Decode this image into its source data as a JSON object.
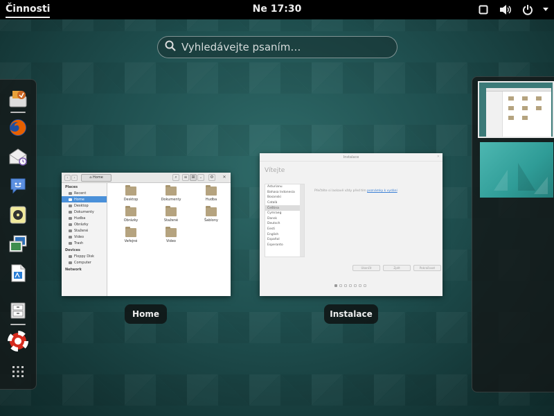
{
  "topbar": {
    "activities": "Činnosti",
    "clock": "Ne 17:30",
    "tray_icons": [
      "window-icon",
      "volume-icon",
      "power-icon"
    ]
  },
  "search": {
    "placeholder": "Vyhledávejte psaním…"
  },
  "dash": {
    "apps": [
      {
        "name": "software-installer-icon",
        "running": true
      },
      {
        "name": "firefox-icon",
        "running": false
      },
      {
        "name": "mail-icon",
        "running": false
      },
      {
        "name": "chat-icon",
        "running": false
      },
      {
        "name": "music-player-icon",
        "running": false
      },
      {
        "name": "photos-icon",
        "running": false
      },
      {
        "name": "document-writer-icon",
        "running": false
      },
      {
        "name": "files-icon",
        "running": true
      },
      {
        "name": "help-icon",
        "running": false
      },
      {
        "name": "show-apps-icon",
        "running": false
      }
    ]
  },
  "windows": {
    "files": {
      "caption": "Home",
      "path_label": "Home",
      "sidebar": {
        "places_header": "Places",
        "places": [
          "Recent",
          "Home",
          "Desktop",
          "Dokumenty",
          "Hudba",
          "Obrázky",
          "Stažené",
          "Video",
          "Trash"
        ],
        "selected": "Home",
        "devices_header": "Devices",
        "devices": [
          "Floppy Disk",
          "Computer"
        ],
        "network_header": "Network"
      },
      "folders": [
        "Desktop",
        "Dokumenty",
        "Hudba",
        "Obrázky",
        "Stažené",
        "Šablony",
        "Veřejné",
        "Video"
      ]
    },
    "installer": {
      "caption": "Instalace",
      "title": "Instalace",
      "heading": "Vítejte",
      "languages": [
        "Asturianu",
        "Bahasa Indonesia",
        "Bosanski",
        "Català",
        "Čeština",
        "Cymraeg",
        "Dansk",
        "Deutsch",
        "Eesti",
        "English",
        "Español",
        "Esperanto"
      ],
      "selected_language": "Čeština",
      "text_prefix": "Přečtěte si laskavě vždy před tím ",
      "text_link": "poznámky k vydání",
      "buttons": [
        "Ukončit",
        "Zpět",
        "Pokračovat"
      ],
      "step": 1,
      "steps_total": 7
    }
  },
  "workspaces": {
    "count": 2,
    "active": 1
  }
}
